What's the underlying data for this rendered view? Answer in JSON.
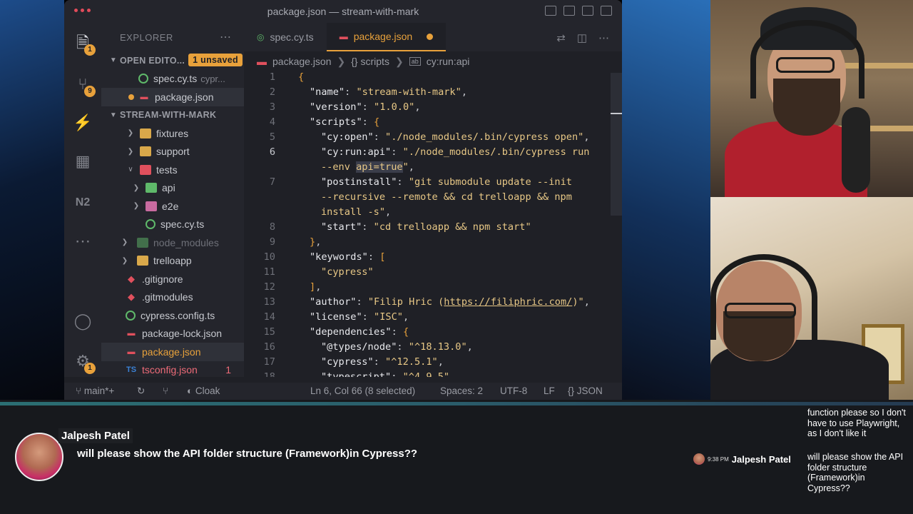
{
  "window": {
    "title": "package.json — stream-with-mark"
  },
  "activity_bar": {
    "explorer_badge": "1",
    "scm_badge": "9",
    "settings_badge": "1"
  },
  "sidebar": {
    "header": "EXPLORER",
    "open_editors": {
      "label": "OPEN EDITO...",
      "badge": "1 unsaved",
      "items": [
        {
          "name": "spec.cy.ts",
          "suffix": "cypr..."
        },
        {
          "name": "package.json"
        }
      ]
    },
    "project": {
      "label": "STREAM-WITH-MARK",
      "items": [
        {
          "name": "fixtures"
        },
        {
          "name": "support"
        },
        {
          "name": "tests"
        },
        {
          "name": "api"
        },
        {
          "name": "e2e"
        },
        {
          "name": "spec.cy.ts"
        },
        {
          "name": "node_modules"
        },
        {
          "name": "trelloapp"
        },
        {
          "name": ".gitignore"
        },
        {
          "name": ".gitmodules"
        },
        {
          "name": "cypress.config.ts"
        },
        {
          "name": "package-lock.json"
        },
        {
          "name": "package.json"
        },
        {
          "name": "tsconfig.json",
          "problems": "1"
        }
      ]
    }
  },
  "tabs": [
    {
      "label": "spec.cy.ts"
    },
    {
      "label": "package.json"
    }
  ],
  "breadcrumb": [
    "package.json",
    "{} scripts",
    "cy:run:api"
  ],
  "editor": {
    "lines": [
      {
        "n": "1"
      },
      {
        "n": "2"
      },
      {
        "n": "3"
      },
      {
        "n": "4"
      },
      {
        "n": "5"
      },
      {
        "n": "6"
      },
      {
        "n": "7"
      },
      {
        "n": "8"
      },
      {
        "n": "9"
      },
      {
        "n": "10"
      },
      {
        "n": "11"
      },
      {
        "n": "12"
      },
      {
        "n": "13"
      },
      {
        "n": "14"
      },
      {
        "n": "15"
      },
      {
        "n": "16"
      },
      {
        "n": "17"
      },
      {
        "n": "18"
      }
    ],
    "json": {
      "name": "stream-with-mark",
      "version": "1.0.0",
      "cy_open": "./node_modules/.bin/cypress open",
      "cy_run_api_1": "./node_modules/.bin/cypress run",
      "cy_run_api_2a": "--env ",
      "cy_run_api_2b": "api=true",
      "postinstall_1": "git submodule update --init",
      "postinstall_2": "--recursive --remote && cd trelloapp && npm",
      "postinstall_3": "install -s",
      "start": "cd trelloapp && npm start",
      "keyword": "cypress",
      "author_name": "Filip Hric (",
      "author_url": "https://filiphric.com/",
      "author_end": ")",
      "license": "ISC",
      "types_node": "^18.13.0",
      "cypress": "^12.5.1",
      "typescript": "^4.9.5"
    }
  },
  "status_bar": {
    "branch": "main*+",
    "cloak": "Cloak",
    "cursor": "Ln 6, Col 66 (8 selected)",
    "spaces": "Spaces: 2",
    "encoding": "UTF-8",
    "eol": "LF",
    "language": "JSON"
  },
  "chat": {
    "featured": {
      "name": "Jalpesh Patel",
      "message": "will please show the API folder structure (Framework)in Cypress??"
    },
    "sidebar_messages": [
      {
        "text": "function please so I don't have to use Playwright, as I don't like it"
      },
      {
        "time": "9:38 PM",
        "name": "Jalpesh Patel",
        "text": "will please show the API folder structure (Framework)in Cypress??"
      }
    ]
  },
  "colors": {
    "accent": "#e8a13b",
    "editor_bg": "#1f2026",
    "chrome_bg": "#24252c",
    "string": "#e8c886"
  }
}
